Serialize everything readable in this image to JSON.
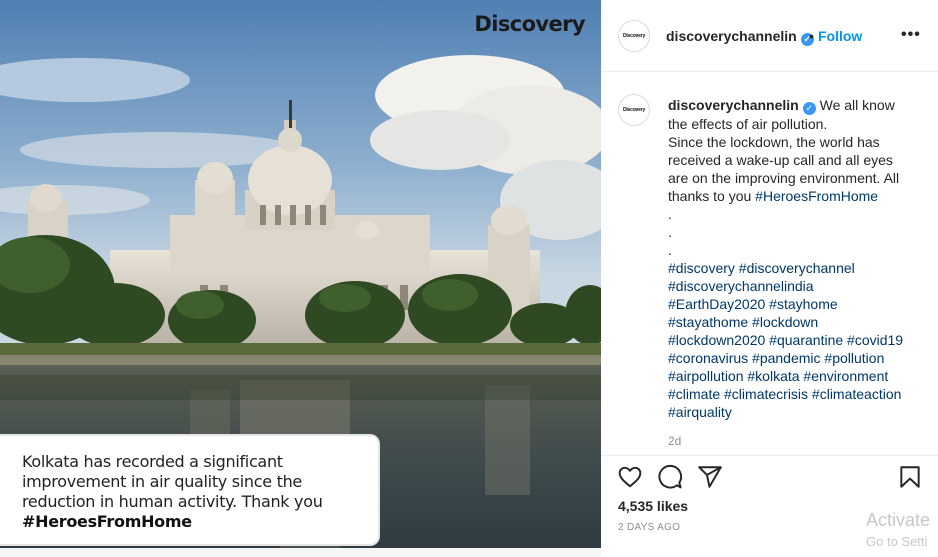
{
  "image": {
    "brand": "Discovery",
    "caption_lines": [
      "Kolkata has recorded a significant",
      "improvement in air quality since the",
      "reduction in human activity. Thank you"
    ],
    "caption_hashtag": "#HeroesFromHome"
  },
  "header": {
    "avatar_text": "Discovery",
    "username": "discoverychannelin",
    "verified_icon": "verified-check",
    "separator": "•",
    "follow_label": "Follow",
    "more_label": "•••"
  },
  "comment": {
    "avatar_text": "Discovery",
    "username": "discoverychannelin",
    "lines": [
      "We all know",
      "the effects of air pollution.",
      "Since the lockdown, the world has",
      "received a wake-up call and all eyes",
      "are on the improving environment. All"
    ],
    "last_line_prefix": "thanks to you ",
    "last_line_tag": "#HeroesFromHome",
    "dots": [
      ".",
      ".",
      "."
    ],
    "hashtag_lines": [
      "#discovery #discoverychannel",
      "#discoverychannelindia",
      "#EarthDay2020 #stayhome",
      "#stayathome #lockdown",
      "#lockdown2020 #quarantine #covid19",
      "#coronavirus #pandemic #pollution",
      "#airpollution #kolkata #environment",
      "#climate #climatecrisis #climateaction",
      "#airquality"
    ],
    "time_ago": "2d"
  },
  "actions": {
    "icons": [
      "heart-icon",
      "comment-icon",
      "share-icon",
      "bookmark-icon"
    ],
    "likes": "4,535 likes",
    "posted": "2 DAYS AGO"
  },
  "watermark": {
    "title": "Activate",
    "subtitle": "Go to Setti"
  },
  "colors": {
    "link": "#00376b",
    "follow": "#0095f6",
    "verified": "#3897f0"
  }
}
